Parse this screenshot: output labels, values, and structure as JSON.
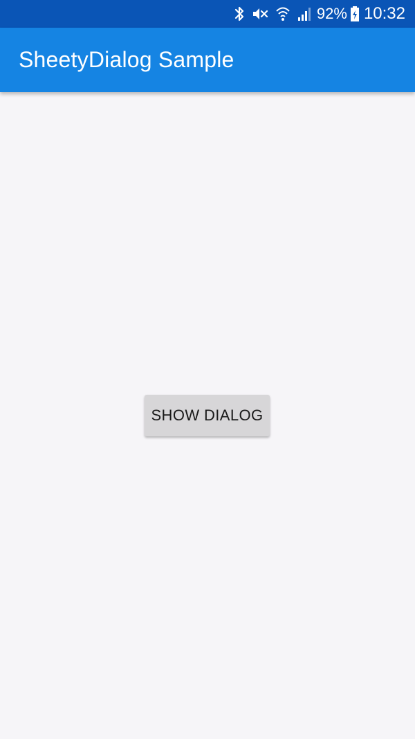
{
  "status_bar": {
    "icons": [
      "bluetooth-icon",
      "mute-icon",
      "wifi-icon",
      "signal-icon",
      "battery-icon"
    ],
    "battery_level": "92%",
    "time": "10:32",
    "background_color": "#0a55b6"
  },
  "app_bar": {
    "title": "SheetyDialog Sample",
    "background_color": "#1584e3"
  },
  "main": {
    "button_label": "SHOW DIALOG",
    "background_color": "#f6f5f8"
  }
}
